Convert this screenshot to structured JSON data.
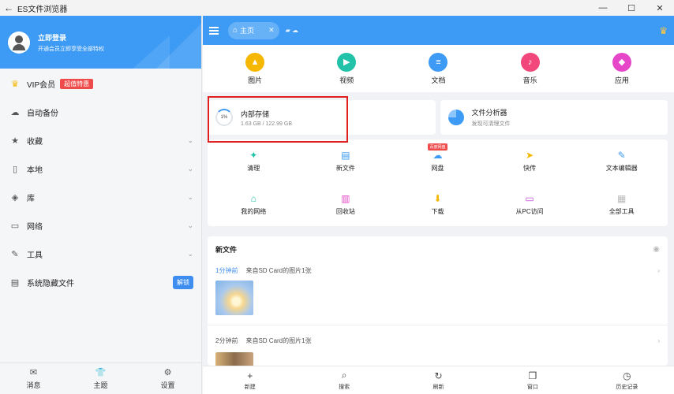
{
  "window": {
    "title": "ES文件浏览器",
    "back_glyph": "←",
    "minimize_glyph": "—",
    "maximize_glyph": "☐",
    "close_glyph": "✕"
  },
  "drawer": {
    "user": {
      "name": "立即登录",
      "subtitle": "开通会员立即享受全部特权"
    },
    "items": [
      {
        "label": "VIP会员",
        "icon": "vip-crown-icon",
        "glyph": "♛",
        "badge": "超值特惠"
      },
      {
        "label": "自动备份",
        "icon": "cloud-icon",
        "glyph": "☁"
      },
      {
        "label": "收藏",
        "icon": "star-icon",
        "glyph": "★",
        "chevron": "⌄"
      },
      {
        "label": "本地",
        "icon": "phone-icon",
        "glyph": "▯",
        "chevron": "⌄"
      },
      {
        "label": "库",
        "icon": "layers-icon",
        "glyph": "◈",
        "chevron": "⌄"
      },
      {
        "label": "网络",
        "icon": "network-icon",
        "glyph": "▭",
        "chevron": "⌄"
      },
      {
        "label": "工具",
        "icon": "wrench-icon",
        "glyph": "✎",
        "chevron": "⌄"
      },
      {
        "label": "系统隐藏文件",
        "icon": "hidden-files-icon",
        "glyph": "▤",
        "action": "解锁"
      }
    ],
    "bottom": [
      {
        "label": "消息",
        "icon": "message-icon",
        "glyph": "✉"
      },
      {
        "label": "主题",
        "icon": "shirt-icon",
        "glyph": "👕"
      },
      {
        "label": "设置",
        "icon": "gear-icon",
        "glyph": "⚙"
      }
    ]
  },
  "topbar": {
    "tab_label": "主页",
    "home_glyph": "⌂",
    "close_glyph": "✕",
    "mini_glyphs": "▰ ☁",
    "crown_glyph": "♛"
  },
  "categories": [
    {
      "label": "图片",
      "color": "#f5b700",
      "glyph": "▲"
    },
    {
      "label": "视频",
      "color": "#21c2a8",
      "glyph": "▶"
    },
    {
      "label": "文档",
      "color": "#3d9bf5",
      "glyph": "≡"
    },
    {
      "label": "音乐",
      "color": "#f2477a",
      "glyph": "♪"
    },
    {
      "label": "应用",
      "color": "#e547c8",
      "glyph": "◆"
    }
  ],
  "storage": {
    "internal": {
      "title": "内部存储",
      "usage": "1.63 GB / 122.99 GB",
      "percent_label": "1%"
    },
    "analyzer": {
      "title": "文件分析器",
      "subtitle": "发现可清理文件"
    }
  },
  "tools": [
    {
      "label": "清理",
      "color": "#21c2a8",
      "glyph": "✦"
    },
    {
      "label": "新文件",
      "color": "#3d9bf5",
      "glyph": "▤"
    },
    {
      "label": "网盘",
      "color": "#3d9bf5",
      "glyph": "☁",
      "badge": "百度网盘"
    },
    {
      "label": "快传",
      "color": "#f5b700",
      "glyph": "➤"
    },
    {
      "label": "文本编辑器",
      "color": "#3d9bf5",
      "glyph": "✎"
    },
    {
      "label": "我的网络",
      "color": "#21c2a8",
      "glyph": "⌂"
    },
    {
      "label": "回收站",
      "color": "#e547c8",
      "glyph": "▥"
    },
    {
      "label": "下载",
      "color": "#f5b700",
      "glyph": "⬇"
    },
    {
      "label": "从PC访问",
      "color": "#c04bd9",
      "glyph": "▭"
    },
    {
      "label": "全部工具",
      "color": "#bbbbbb",
      "glyph": "▦"
    }
  ],
  "new_files": {
    "title": "新文件",
    "eye_glyph": "◉",
    "entries": [
      {
        "time": "1分钟前",
        "desc": "来自SD Card的图片1张",
        "arrow": "›"
      },
      {
        "time": "2分钟前",
        "desc": "来自SD Card的图片1张",
        "arrow": "›"
      }
    ]
  },
  "bottombar": [
    {
      "label": "新建",
      "icon": "plus-icon",
      "glyph": "+"
    },
    {
      "label": "搜索",
      "icon": "search-icon",
      "glyph": "⌕"
    },
    {
      "label": "刷新",
      "icon": "refresh-icon",
      "glyph": "↻"
    },
    {
      "label": "窗口",
      "icon": "windows-icon",
      "glyph": "❐"
    },
    {
      "label": "历史记录",
      "icon": "history-icon",
      "glyph": "◷"
    }
  ]
}
